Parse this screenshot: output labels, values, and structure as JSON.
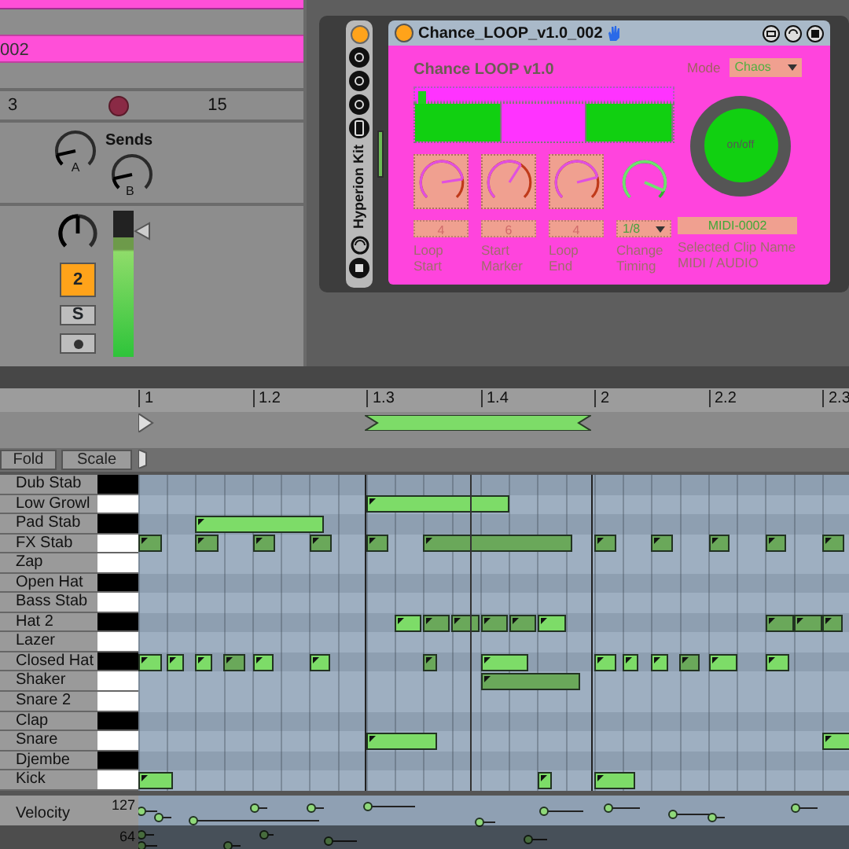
{
  "mixer": {
    "clip": {
      "name": "002"
    },
    "scroll_values": [
      "3",
      "15"
    ],
    "sends": {
      "title": "Sends",
      "knobs": [
        {
          "label": "A"
        },
        {
          "label": "B"
        }
      ]
    },
    "track_activator": {
      "label": "2",
      "on": true
    },
    "solo": {
      "label": "S",
      "on": false
    },
    "arm": {
      "on": false
    },
    "meter": {
      "level": 0.82
    }
  },
  "rack": {
    "name": "Hyperion Kit",
    "on": true
  },
  "device": {
    "title": "Chance_LOOP_v1.0_002",
    "on": true,
    "heading": "Chance LOOP v1.0",
    "mode": {
      "label": "Mode",
      "value": "Chaos"
    },
    "segments": [
      {
        "on": true
      },
      {
        "on": false
      },
      {
        "on": true
      }
    ],
    "controls": [
      {
        "kind": "knob",
        "value": "4",
        "label": "Loop Start"
      },
      {
        "kind": "knob",
        "value": "6",
        "label": "Start Marker"
      },
      {
        "kind": "knob",
        "value": "4",
        "label": "Loop End"
      },
      {
        "kind": "dial",
        "value": "1/8",
        "label": "Change Timing"
      }
    ],
    "power": {
      "label": "on/off",
      "on": true
    },
    "clip_name": {
      "value": "MIDI-0002",
      "label": [
        "Selected Clip Name",
        "MIDI / AUDIO"
      ]
    }
  },
  "piano_roll": {
    "ruler": [
      "1",
      "1.2",
      "1.3",
      "1.4",
      "2",
      "2.2",
      "2.3"
    ],
    "buttons": [
      {
        "label": "Fold",
        "selected": false
      },
      {
        "label": "Scale",
        "selected": false
      }
    ],
    "rows": [
      {
        "name": "Dub Stab",
        "black_key": true
      },
      {
        "name": "Low Growl",
        "black_key": false
      },
      {
        "name": "Pad Stab",
        "black_key": true
      },
      {
        "name": "FX Stab",
        "black_key": false
      },
      {
        "name": "Zap",
        "black_key": false
      },
      {
        "name": "Open Hat",
        "black_key": true
      },
      {
        "name": "Bass Stab",
        "black_key": false
      },
      {
        "name": "Hat 2",
        "black_key": true
      },
      {
        "name": "Lazer",
        "black_key": false
      },
      {
        "name": "Closed Hat",
        "black_key": true
      },
      {
        "name": "Shaker",
        "black_key": false
      },
      {
        "name": "Snare 2",
        "black_key": false
      },
      {
        "name": "Clap",
        "black_key": true
      },
      {
        "name": "Snare",
        "black_key": false
      },
      {
        "name": "Djembe",
        "black_key": true
      },
      {
        "name": "Kick",
        "black_key": false
      }
    ],
    "velocity": {
      "label": "Velocity",
      "ticks": [
        "127",
        "64"
      ]
    }
  }
}
